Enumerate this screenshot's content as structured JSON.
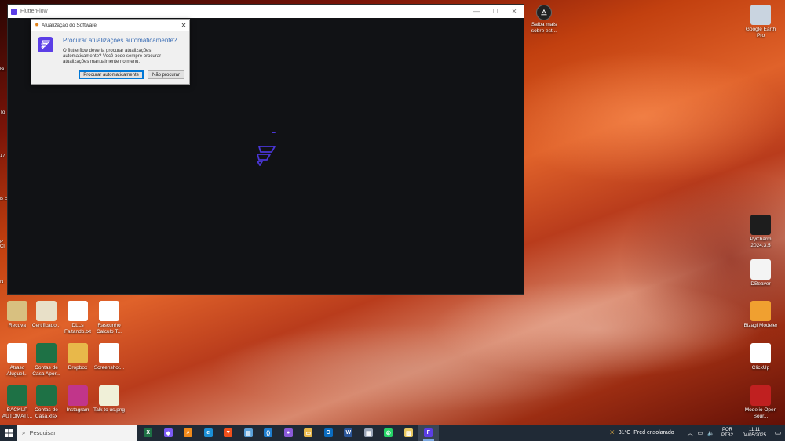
{
  "app_window": {
    "title": "FlutterFlow",
    "controls": {
      "minimize": "—",
      "maximize": "☐",
      "close": "✕"
    }
  },
  "dialog": {
    "title": "Atualização do Software",
    "close": "✕",
    "heading": "Procurar atualizações automaticamente?",
    "message": "O flutterflow deveria procurar atualizações automaticamente? Você pode sempre procurar atualizações manualmente no menu.",
    "btn_auto": "Procurar automaticamente",
    "btn_no": "Não procurar"
  },
  "desktop_left": [
    {
      "label": "Recuva",
      "icon": "recuva-icon",
      "color": "#d8c080"
    },
    {
      "label": "Certificado...",
      "icon": "certificate-icon",
      "color": "#e8e0c8"
    },
    {
      "label": "DLLs Faltando.txt",
      "icon": "text-file-icon",
      "color": "#ffffff"
    },
    {
      "label": "Rascunho Calculo T...",
      "icon": "text-file-icon",
      "color": "#ffffff"
    },
    {
      "label": "Atraso Aluguel...",
      "icon": "pdf-icon",
      "color": "#ffffff"
    },
    {
      "label": "Contas de Casa Apor...",
      "icon": "excel-icon",
      "color": "#1e7145"
    },
    {
      "label": "Dropbox",
      "icon": "folder-icon",
      "color": "#e8b84a"
    },
    {
      "label": "Screenshot...",
      "icon": "image-file-icon",
      "color": "#ffffff"
    },
    {
      "label": "BACKUP AUTOMATI...",
      "icon": "excel-icon",
      "color": "#1e7145"
    },
    {
      "label": "Contas de Casa.xlsx",
      "icon": "excel-icon",
      "color": "#1e7145"
    },
    {
      "label": "Instagram",
      "icon": "instagram-icon",
      "color": "#c1358a"
    },
    {
      "label": "Talk to us.png",
      "icon": "image-file-icon",
      "color": "#f0f0d8"
    }
  ],
  "desktop_right": [
    {
      "label": "Google Earth Pro",
      "icon": "google-earth-icon",
      "color": "#c9d4e0"
    },
    {
      "label": "PyCharm 2024.3.5",
      "icon": "pycharm-icon",
      "color": "#1d1d1d"
    },
    {
      "label": "DBeaver",
      "icon": "dbeaver-icon",
      "color": "#f4f4f4"
    },
    {
      "label": "Bizagi Modeler",
      "icon": "bizagi-icon",
      "color": "#f0a030"
    },
    {
      "label": "ClickUp",
      "icon": "clickup-icon",
      "color": "#ffffff"
    },
    {
      "label": "Modelio Open Sour...",
      "icon": "modelio-icon",
      "color": "#c02020"
    }
  ],
  "desktop_top": {
    "label": "Saiba mais sobre est...",
    "icon": "learn-more-icon"
  },
  "edge_labels": [
    "Bu",
    "To",
    "17",
    "B E",
    "P Cl",
    "N"
  ],
  "taskbar": {
    "search_placeholder": "Pesquisar",
    "apps": [
      {
        "name": "excel",
        "glyph": "X",
        "color": "#1e7145"
      },
      {
        "name": "copilot",
        "glyph": "◆",
        "color": "#7a5af5"
      },
      {
        "name": "search-everything",
        "glyph": "⌕",
        "color": "#f08a1c"
      },
      {
        "name": "edge",
        "glyph": "e",
        "color": "#1b8fd6"
      },
      {
        "name": "brave",
        "glyph": "▼",
        "color": "#f0501c"
      },
      {
        "name": "notes",
        "glyph": "▤",
        "color": "#5aa0d8"
      },
      {
        "name": "vscode",
        "glyph": "⟨⟩",
        "color": "#1f7fd0"
      },
      {
        "name": "dropper",
        "glyph": "●",
        "color": "#8a5ad8"
      },
      {
        "name": "file-explorer",
        "glyph": "▭",
        "color": "#e8b84a"
      },
      {
        "name": "outlook",
        "glyph": "O",
        "color": "#0a6cc0"
      },
      {
        "name": "word",
        "glyph": "W",
        "color": "#2b579a"
      },
      {
        "name": "calculator",
        "glyph": "▦",
        "color": "#9aa6b8"
      },
      {
        "name": "whatsapp",
        "glyph": "✆",
        "color": "#25d366"
      },
      {
        "name": "image-viewer",
        "glyph": "▨",
        "color": "#e8c860"
      },
      {
        "name": "flutterflow",
        "glyph": "F",
        "color": "#5b3ee6"
      }
    ],
    "weather": {
      "temp": "31°C",
      "desc": "Pred ensolarado"
    },
    "lang": {
      "line1": "POR",
      "line2": "PTB2"
    },
    "clock": {
      "time": "11:11",
      "date": "04/05/2025"
    }
  }
}
